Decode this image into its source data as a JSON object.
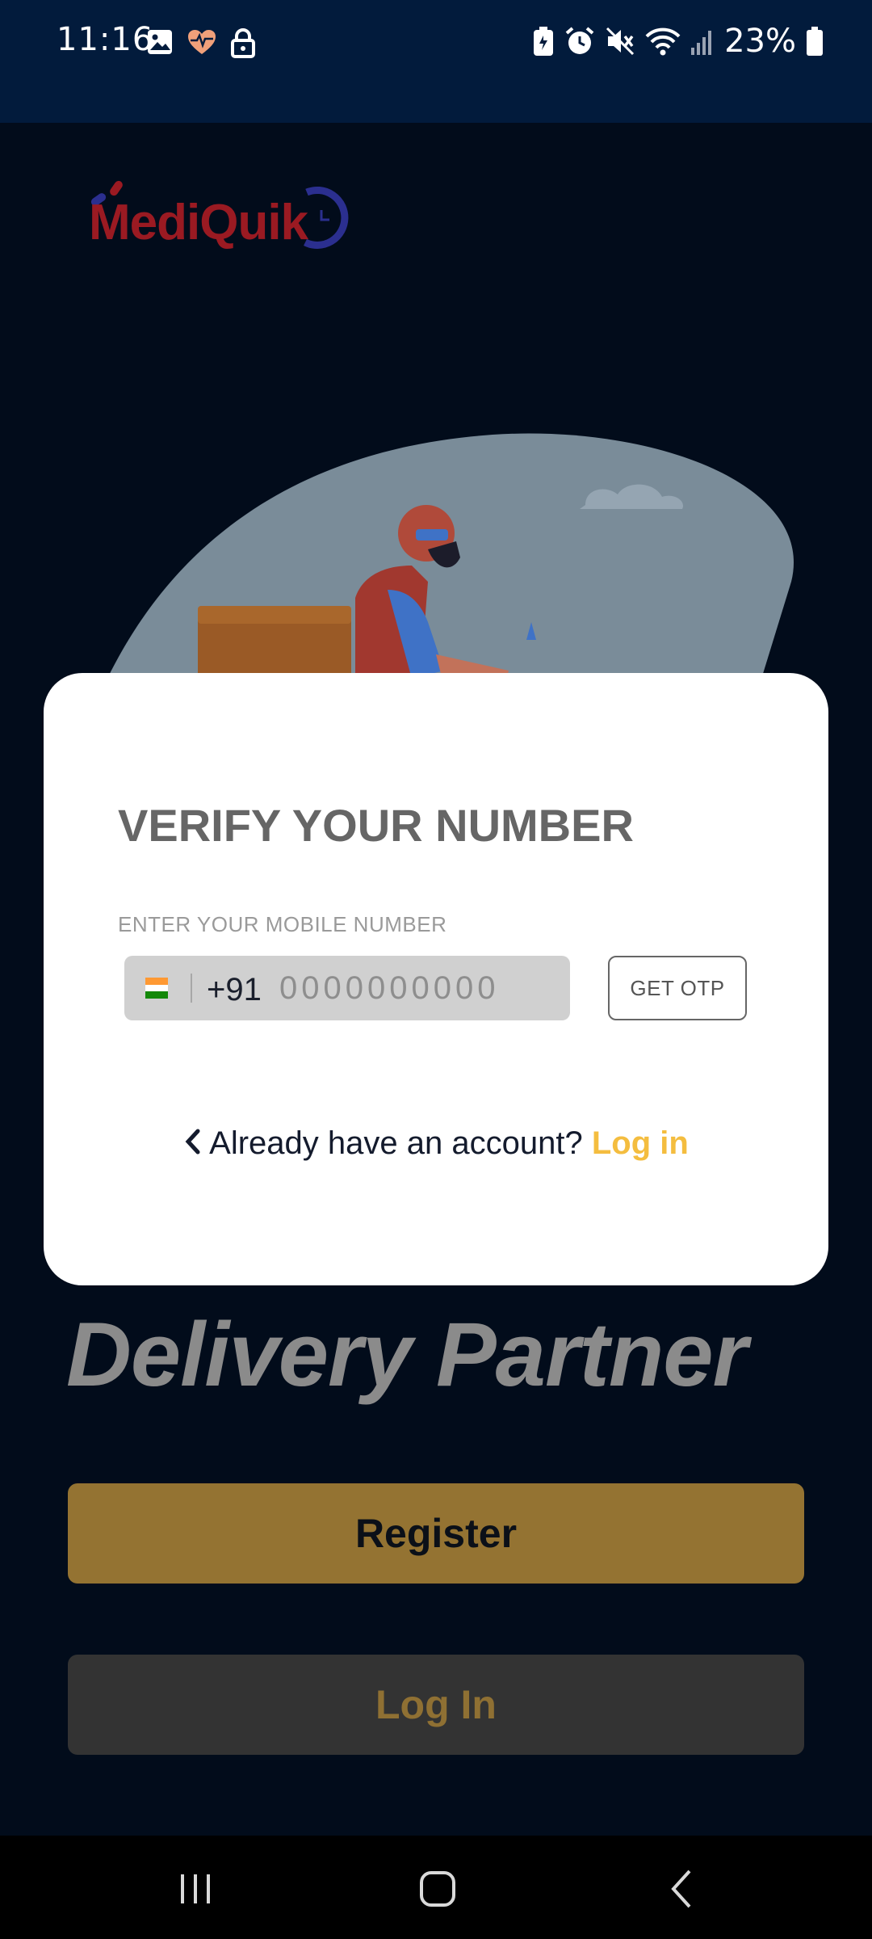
{
  "status_bar": {
    "time": "11:16",
    "battery_percent": "23%",
    "left_icons": [
      "image-icon",
      "heart-rate-icon",
      "lock-icon"
    ],
    "right_icons": [
      "battery-saver-icon",
      "alarm-icon",
      "mute-icon",
      "wifi-icon",
      "signal-icon",
      "battery-icon"
    ]
  },
  "app": {
    "logo_text": "MediQuik",
    "headline": "Delivery Partner",
    "register_label": "Register",
    "login_label": "Log In"
  },
  "modal": {
    "title": "VERIFY YOUR NUMBER",
    "field_label": "ENTER YOUR MOBILE NUMBER",
    "country_code": "+91",
    "phone_placeholder": "0000000000",
    "phone_value": "",
    "get_otp_label": "GET OTP",
    "account_prompt": "Already have an account?",
    "login_link": "Log in"
  },
  "colors": {
    "background": "#020c1b",
    "status_bar": "#021b3c",
    "register_button": "#947332",
    "login_button": "#333333",
    "accent": "#f4bd3f",
    "logo_red": "#9a1a22",
    "logo_blue": "#2b2f8f"
  },
  "nav_bar": {
    "buttons": [
      "recent-apps-icon",
      "home-icon",
      "back-icon"
    ]
  }
}
